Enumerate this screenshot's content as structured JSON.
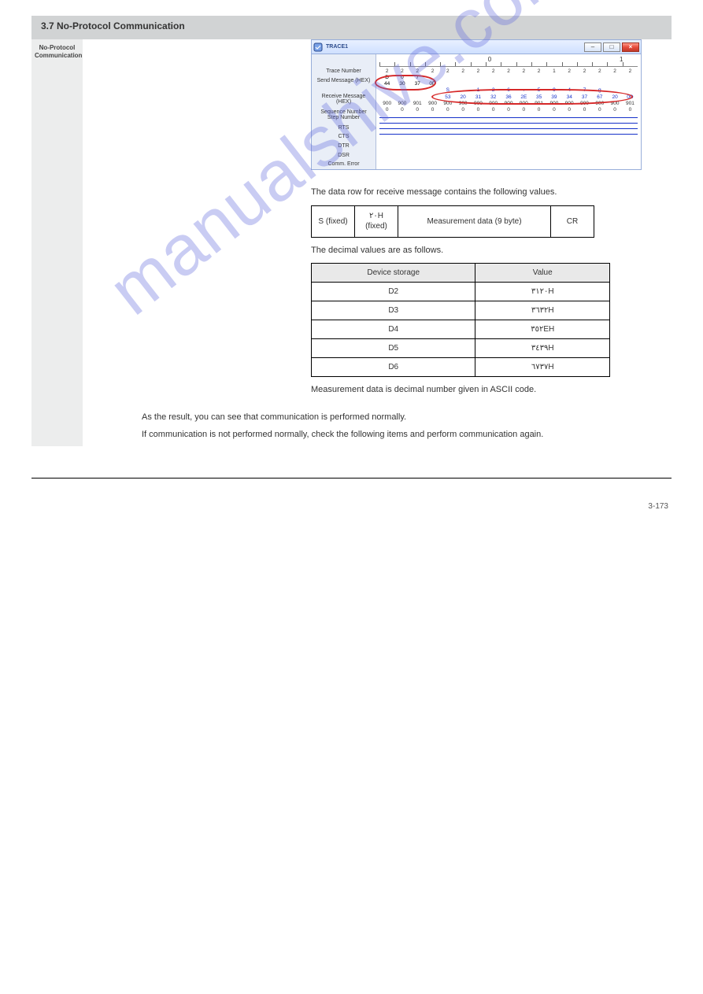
{
  "header": {
    "title": "3.7 No-Protocol Communication"
  },
  "sidebar": {
    "label": "No-Protocol Communication"
  },
  "trace": {
    "title": "TRACE1",
    "axis_big": [
      "0",
      "1"
    ],
    "labels": [
      "Trace Number",
      "Send Message (HEX)",
      "Receive Message (HEX)",
      "Sequence Number Step Number",
      "RTS",
      "CTS",
      "DTR",
      "DSR",
      "Comm. Error"
    ],
    "row_trace_no": [
      "2",
      "2",
      "2",
      "2",
      "2",
      "2",
      "2",
      "2",
      "2",
      "2",
      "2",
      "1",
      "2",
      "2",
      "2",
      "2",
      "2"
    ],
    "row_send_chr": [
      "D",
      "0",
      "7",
      "",
      "",
      "",
      "",
      "",
      "",
      "",
      "",
      "",
      "",
      "",
      "",
      "",
      ""
    ],
    "row_send_hex": [
      "44",
      "30",
      "37",
      "0D",
      "",
      "",
      "",
      "",
      "",
      "",
      "",
      "",
      "",
      "",
      "",
      "",
      ""
    ],
    "row_recv_chr": [
      "",
      "",
      "",
      "",
      "S",
      "",
      "1",
      "2",
      "6",
      ".",
      "5",
      "9",
      "4",
      "7",
      "g",
      "",
      ""
    ],
    "row_recv_hex": [
      "",
      "",
      "",
      "",
      "53",
      "20",
      "31",
      "32",
      "36",
      "2E",
      "35",
      "39",
      "34",
      "37",
      "67",
      "20",
      "0D"
    ],
    "row_seq_top": [
      "900",
      "900",
      "901",
      "900",
      "900",
      "900",
      "900",
      "900",
      "900",
      "900",
      "901",
      "900",
      "900",
      "900",
      "900",
      "900",
      "901"
    ],
    "row_seq_bot": [
      "0",
      "0",
      "0",
      "0",
      "0",
      "0",
      "0",
      "0",
      "0",
      "0",
      "0",
      "0",
      "0",
      "0",
      "0",
      "0",
      "0"
    ]
  },
  "section_line": "The data row for receive message contains the following values.",
  "cmd_table": {
    "cells": [
      "S (fixed)",
      "٢٠H (fixed)",
      "Measurement data (9 byte)",
      "CR"
    ]
  },
  "resp_intro": "The decimal values are as follows.",
  "resp_table": {
    "head": [
      "Device storage",
      "Value"
    ],
    "rows": [
      [
        "D2",
        "٣١٢٠H"
      ],
      [
        "D3",
        "٣٦٣٢H"
      ],
      [
        "D4",
        "٣٥٢EH"
      ],
      [
        "D5",
        "٣٤٣٩H"
      ],
      [
        "D6",
        "٦٧٣٧H"
      ]
    ]
  },
  "resp_note": "Measurement data is decimal number given in ASCII code.",
  "body_para_1": "As the result, you can see that communication is performed normally.",
  "body_para_2": "If communication is not performed normally, check the following items and perform communication again.",
  "watermark": "manualshive.com",
  "page_num": "3-173"
}
